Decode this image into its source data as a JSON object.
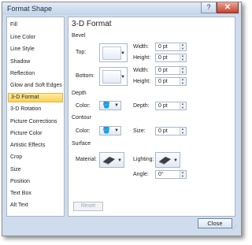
{
  "window": {
    "title": "Format Shape",
    "help_label": "?",
    "close_glyph": "✕"
  },
  "sidebar": {
    "items": [
      {
        "label": "Fill"
      },
      {
        "label": "Line Color"
      },
      {
        "label": "Line Style"
      },
      {
        "label": "Shadow"
      },
      {
        "label": "Reflection"
      },
      {
        "label": "Glow and Soft Edges"
      },
      {
        "label": "3-D Format",
        "selected": true
      },
      {
        "label": "3-D Rotation"
      },
      {
        "label": "Picture Corrections"
      },
      {
        "label": "Picture Color"
      },
      {
        "label": "Artistic Effects"
      },
      {
        "label": "Crop"
      },
      {
        "label": "Size"
      },
      {
        "label": "Position"
      },
      {
        "label": "Text Box"
      },
      {
        "label": "Alt Text"
      }
    ]
  },
  "panel": {
    "heading": "3-D Format",
    "bevel": {
      "section": "Bevel",
      "top_label": "Top:",
      "bottom_label": "Bottom:",
      "top_width_label": "Width:",
      "top_width": "0 pt",
      "top_height_label": "Height:",
      "top_height": "0 pt",
      "bottom_width_label": "Width:",
      "bottom_width": "0 pt",
      "bottom_height_label": "Height:",
      "bottom_height": "0 pt"
    },
    "depth": {
      "section": "Depth",
      "color_label": "Color:",
      "depth_label": "Depth:",
      "depth_value": "0 pt"
    },
    "contour": {
      "section": "Contour",
      "color_label": "Color:",
      "size_label": "Size:",
      "size_value": "0 pt"
    },
    "surface": {
      "section": "Surface",
      "material_label": "Material:",
      "lighting_label": "Lighting:",
      "angle_label": "Angle:",
      "angle_value": "0°"
    },
    "reset_label": "Reset"
  },
  "footer": {
    "close_label": "Close"
  },
  "colors": {
    "window_bg": "#cfdced",
    "selected_item": "#f8d25a",
    "close_button": "#c5452e"
  }
}
